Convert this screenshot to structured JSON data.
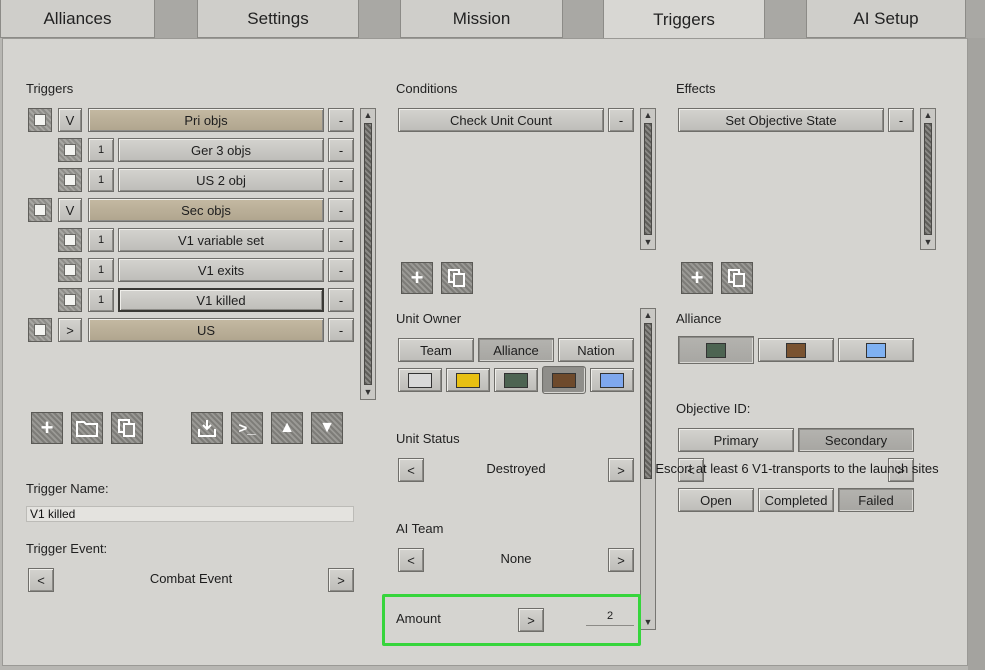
{
  "tabs": [
    "Alliances",
    "Settings",
    "Mission",
    "Triggers",
    "AI Setup"
  ],
  "triggers": {
    "label": "Triggers",
    "rows": [
      {
        "toggle": "V",
        "name": "Pri objs",
        "group": true
      },
      {
        "toggle": "1",
        "name": "Ger 3 objs",
        "group": false
      },
      {
        "toggle": "1",
        "name": "US 2 obj",
        "group": false
      },
      {
        "toggle": "V",
        "name": "Sec objs",
        "group": true
      },
      {
        "toggle": "1",
        "name": "V1 variable set",
        "group": false
      },
      {
        "toggle": "1",
        "name": "V1 exits",
        "group": false
      },
      {
        "toggle": "1",
        "name": "V1 killed",
        "group": false,
        "selected": true
      },
      {
        "toggle": ">",
        "name": "US",
        "group": true
      }
    ],
    "remove_label": "-",
    "name_label": "Trigger Name:",
    "name_value": "V1 killed",
    "event_label": "Trigger Event:",
    "event_value": "Combat Event",
    "prev": "<",
    "next": ">"
  },
  "conditions": {
    "label": "Conditions",
    "item": "Check Unit Count",
    "remove_label": "-",
    "unit_owner_label": "Unit Owner",
    "owner_tabs": [
      "Team",
      "Alliance",
      "Nation"
    ],
    "owner_selected": "Alliance",
    "unit_status_label": "Unit Status",
    "unit_status_value": "Destroyed",
    "ai_team_label": "AI Team",
    "ai_team_value": "None",
    "amount_label": "Amount",
    "amount_value": "2",
    "prev": "<",
    "next": ">"
  },
  "effects": {
    "label": "Effects",
    "item": "Set Objective State",
    "remove_label": "-",
    "alliance_label": "Alliance",
    "objective_id_label": "Objective ID:",
    "objective_types": [
      "Primary",
      "Secondary"
    ],
    "objective_selected": "Secondary",
    "objective_text": "Escort at least 6 V1-transports to the launch sites",
    "prev": "<",
    "next": ">",
    "states": [
      "Open",
      "Completed",
      "Failed"
    ],
    "state_selected": "Failed"
  },
  "colors": {
    "owner_swatches": [
      "#d9d9d9",
      "#e8c012",
      "#4d6452",
      "#6e4a2c",
      "#7fa8ee"
    ],
    "alliance_swatches": [
      "#4d6452",
      "#7a5330",
      "#7fb1f2"
    ],
    "highlight": "#36d53c"
  },
  "icons": {
    "scroll_up": "▲",
    "scroll_down": "▼",
    "add": "+",
    "folder": "folder-icon",
    "copy": "copy-icon",
    "import": "import-icon",
    "console": ">_",
    "move_up": "▲",
    "move_down": "▼"
  }
}
